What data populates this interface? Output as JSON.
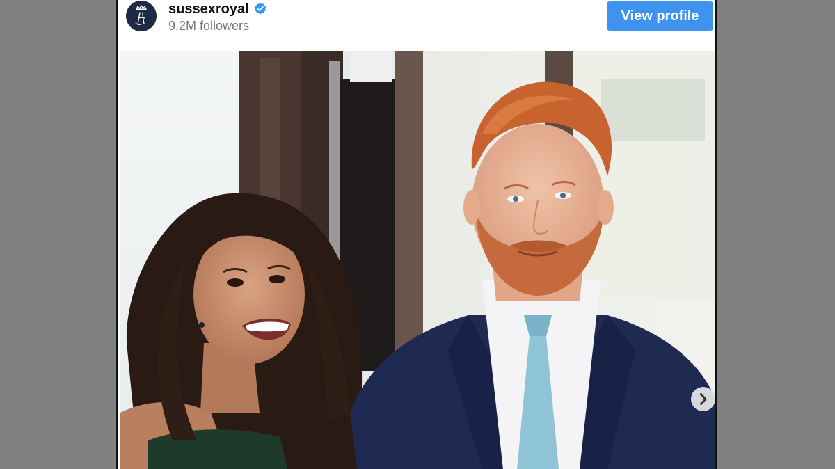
{
  "profile": {
    "username": "sussexroyal",
    "followers": "9.2M followers",
    "verified": true,
    "avatar_icon": "monogram-crown-icon",
    "view_profile_label": "View profile"
  },
  "carousel": {
    "next_icon": "chevron-right-icon"
  },
  "colors": {
    "button_blue": "#3f93ee",
    "verified_blue": "#3897f0",
    "avatar_navy": "#1e2a44",
    "backdrop_gray": "#808080"
  }
}
